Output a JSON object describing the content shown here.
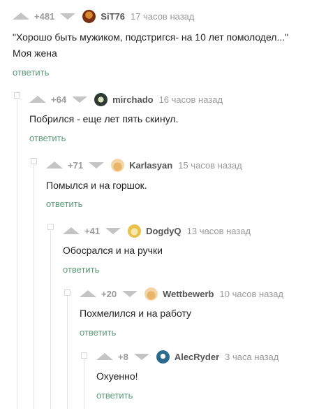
{
  "comments": [
    {
      "rating": "+481",
      "username": "SiT76",
      "time": "17 часов назад",
      "lines": [
        "\"Хорошо быть мужиком, подстригся- на 10 лет помолодел...\"",
        "Моя жена"
      ],
      "reply": "ответить",
      "avatar_color": "#7a2f12"
    },
    {
      "rating": "+64",
      "username": "mirchado",
      "time": "16 часов назад",
      "lines": [
        "Побрился - еще лет пять скинул."
      ],
      "reply": "ответить",
      "avatar_color": "#2f3a35"
    },
    {
      "rating": "+71",
      "username": "Karlasyan",
      "time": "15 часов назад",
      "lines": [
        "Помылся и на горшок."
      ],
      "reply": "ответить",
      "avatar_color": "#f3d6a6"
    },
    {
      "rating": "+41",
      "username": "DogdyQ",
      "time": "13 часов назад",
      "lines": [
        "Обосрался и на ручки"
      ],
      "reply": "ответить",
      "avatar_color": "#e8c04a"
    },
    {
      "rating": "+20",
      "username": "Wettbewerb",
      "time": "10 часов назад",
      "lines": [
        "Похмелился и на работу"
      ],
      "reply": "ответить",
      "avatar_color": "#f3d6a6"
    },
    {
      "rating": "+8",
      "username": "AlecRyder",
      "time": "3 часа назад",
      "lines": [
        "Охуенно!"
      ],
      "reply": "ответить",
      "avatar_color": "#2b6b8f"
    }
  ]
}
